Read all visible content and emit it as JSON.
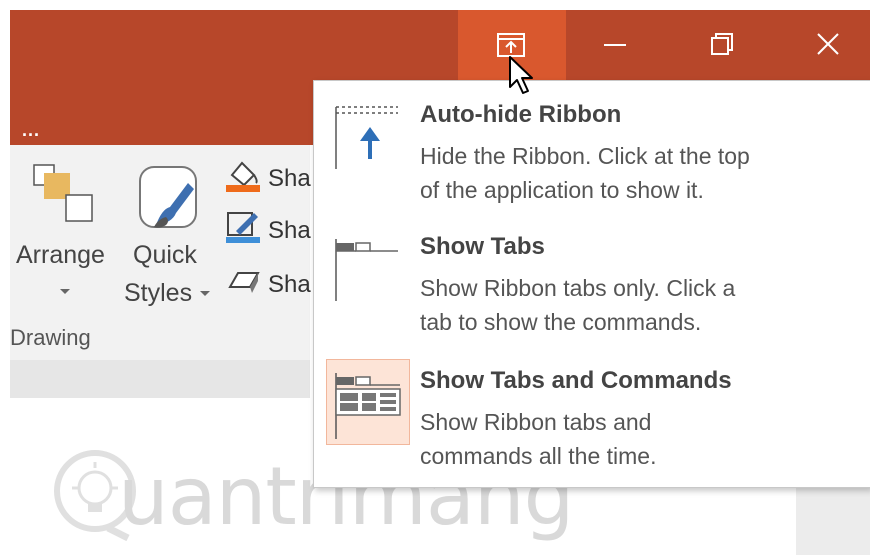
{
  "title_bar": {
    "ellipsis": "...",
    "buttons": [
      {
        "name": "ribbon-display-options",
        "icon": "ribbon-display-icon"
      },
      {
        "name": "minimize",
        "icon": "minimize-icon"
      },
      {
        "name": "restore",
        "icon": "restore-icon"
      },
      {
        "name": "close",
        "icon": "close-icon"
      }
    ],
    "accent_color": "#b7472a",
    "hover_color": "#d9582e"
  },
  "ribbon": {
    "arrange_label": "Arrange",
    "quick_label": "Quick",
    "styles_label": "Styles",
    "shape_fill_label": "Sha",
    "shape_outline_label": "Sha",
    "shape_effects_label": "Sha",
    "group_label": "Drawing"
  },
  "menu": {
    "items": [
      {
        "title": "Auto-hide Ribbon",
        "desc_line1": "Hide the Ribbon. Click at the top",
        "desc_line2": "of the application to show it.",
        "icon": "auto-hide-ribbon-icon"
      },
      {
        "title": "Show Tabs",
        "desc_line1": "Show Ribbon tabs only. Click a",
        "desc_line2": "tab to show the commands.",
        "icon": "show-tabs-icon"
      },
      {
        "title": "Show Tabs and Commands",
        "desc_line1": "Show Ribbon tabs and",
        "desc_line2": "commands all the time.",
        "icon": "show-tabs-commands-icon",
        "selected": true
      }
    ]
  },
  "watermark": {
    "text": "uantrimang"
  }
}
